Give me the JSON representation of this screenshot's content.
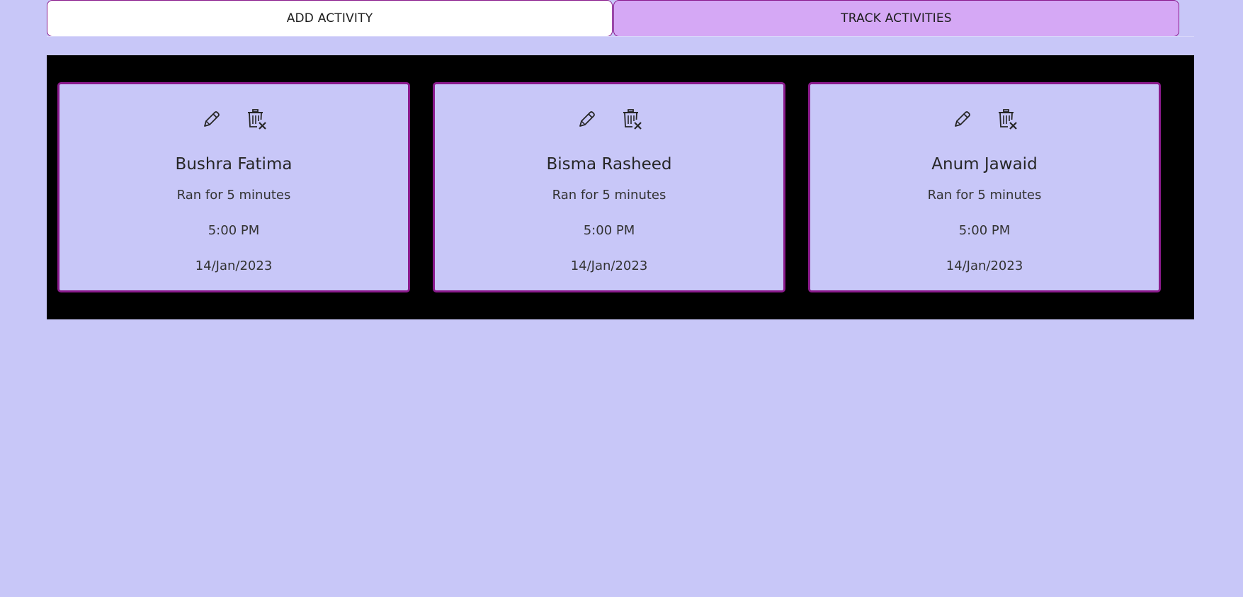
{
  "tabs": {
    "add_label": "ADD ACTIVITY",
    "track_label": "TRACK ACTIVITIES",
    "active": "track"
  },
  "colors": {
    "page_background": "#c8c7f8",
    "panel_background": "#000000",
    "card_border": "#8a1a8c",
    "active_tab_background": "#d5a8f5",
    "inactive_tab_background": "#ffffff"
  },
  "icons": {
    "edit": "pencil-icon",
    "delete": "trash-x-icon"
  },
  "activities": [
    {
      "name": "Bushra Fatima",
      "description": "Ran for 5 minutes",
      "time": "5:00 PM",
      "date": "14/Jan/2023"
    },
    {
      "name": "Bisma Rasheed",
      "description": "Ran for 5 minutes",
      "time": "5:00 PM",
      "date": "14/Jan/2023"
    },
    {
      "name": "Anum Jawaid",
      "description": "Ran for 5 minutes",
      "time": "5:00 PM",
      "date": "14/Jan/2023"
    }
  ]
}
